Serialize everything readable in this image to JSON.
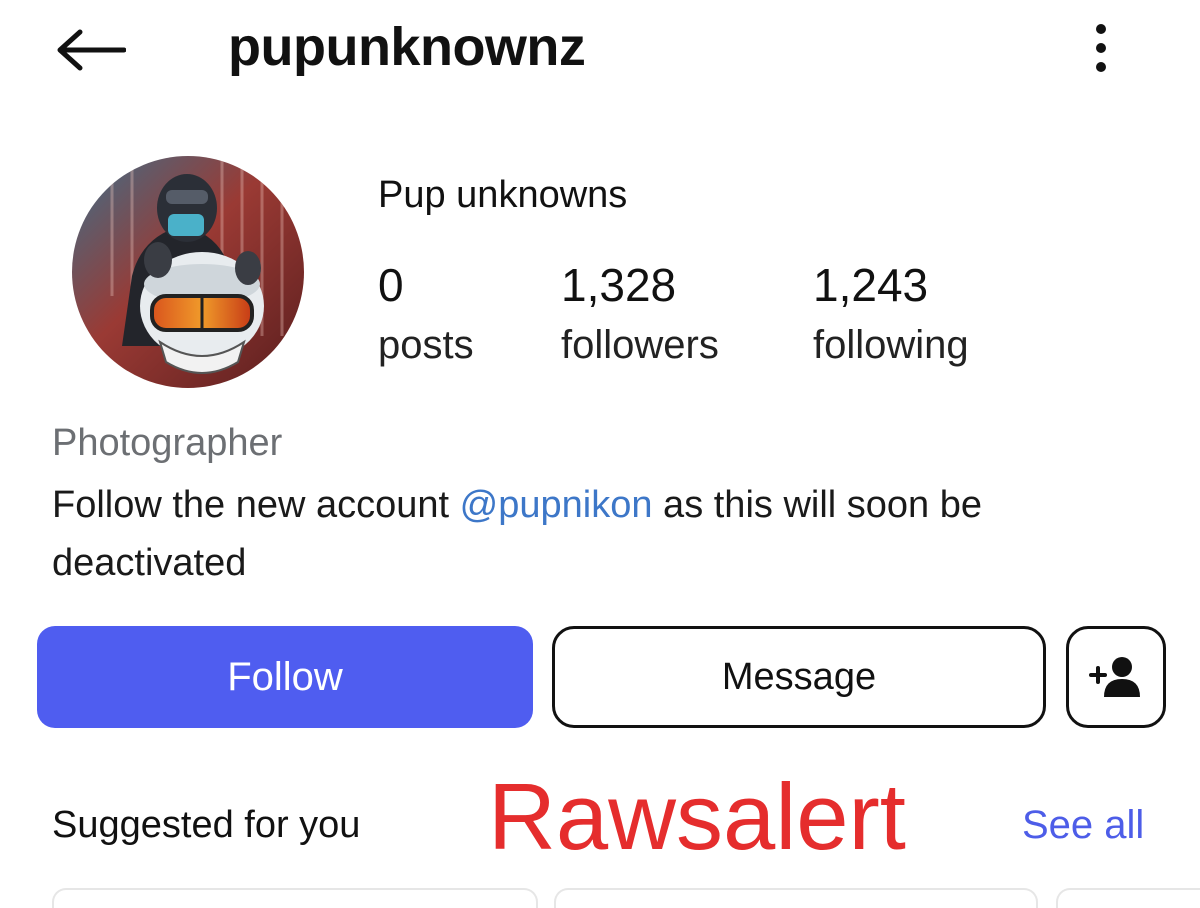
{
  "header": {
    "username": "pupunknownz",
    "back_icon": "arrow-left-icon",
    "more_icon": "more-vertical-icon"
  },
  "profile": {
    "display_name": "Pup unknowns",
    "stats": [
      {
        "value": "0",
        "label": "posts"
      },
      {
        "value": "1,328",
        "label": "followers"
      },
      {
        "value": "1,243",
        "label": "following"
      }
    ],
    "category": "Photographer",
    "bio": {
      "before": "Follow the new account ",
      "mention": "@pupnikon",
      "after": " as this will soon be deactivated"
    }
  },
  "actions": {
    "follow_label": "Follow",
    "message_label": "Message",
    "add_friend_icon": "add-person-icon"
  },
  "suggested": {
    "title": "Suggested for you",
    "see_all": "See all"
  },
  "watermark": "Rawsalert",
  "colors": {
    "follow_button": "#4f5df0",
    "mention": "#3d77c8",
    "see_all": "#4d5de8",
    "watermark": "#e52d2d",
    "category_text": "#6c6f73"
  }
}
